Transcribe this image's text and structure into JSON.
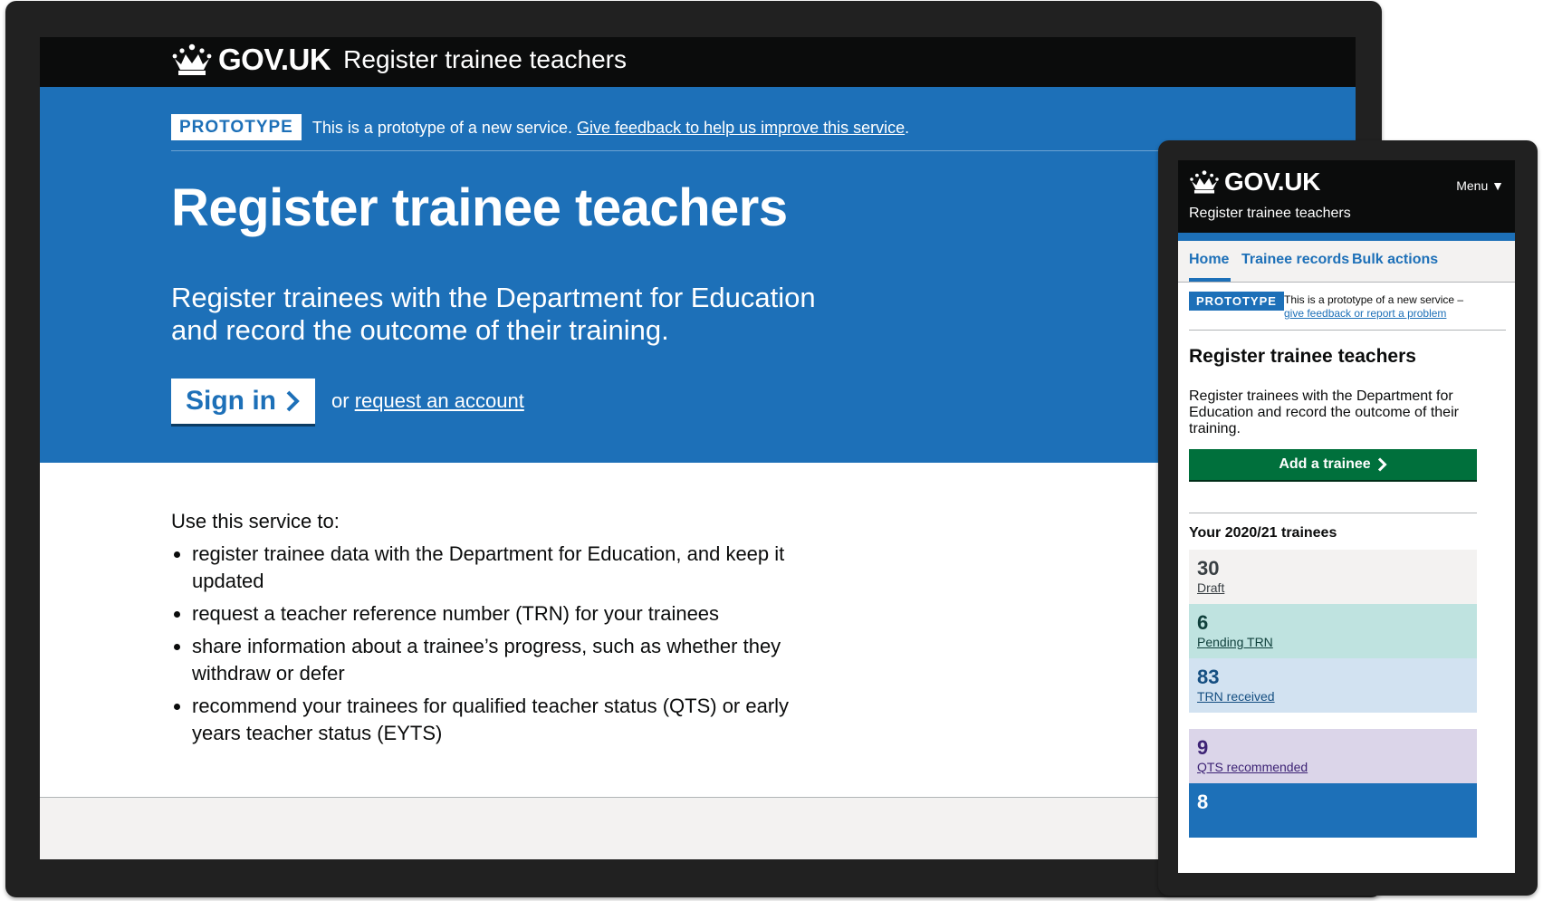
{
  "desktop": {
    "logo": "GOV.UK",
    "service_name": "Register trainee teachers",
    "phase_tag": "PROTOTYPE",
    "phase_text": "This is a prototype of a new service.",
    "phase_link": "Give feedback to help us improve this service",
    "phase_suffix": ".",
    "title": "Register trainee teachers",
    "lede": "Register trainees with the Department for Education and record the outcome of their training.",
    "signin_label": "Sign in",
    "or_text": "or",
    "request_link": "request an account",
    "use_heading": "Use this service to:",
    "bullets": [
      "register trainee data with the Department for Education, and keep it updated",
      "request a teacher reference number (TRN) for your trainees",
      "share information about a trainee’s progress, such as whether they withdraw or defer",
      "recommend your trainees for qualified teacher status (QTS) or early years teacher status (EYTS)"
    ]
  },
  "mobile": {
    "logo": "GOV.UK",
    "menu_label": "Menu ▼",
    "service_name": "Register trainee teachers",
    "nav": [
      "Home",
      "Trainee records",
      "Bulk actions"
    ],
    "phase_tag": "PROTOTYPE",
    "phase_text": "This is a prototype of a new service –",
    "phase_link": "give feedback or report a problem",
    "title": "Register trainee teachers",
    "lede": "Register trainees with the Department for Education and record the outcome of their training.",
    "add_button": "Add a trainee",
    "year_heading": "Your 2020/21 trainees",
    "status_cards": [
      {
        "count": "30",
        "label": "Draft",
        "bg": "#f3f2f1",
        "color": "#383f43"
      },
      {
        "count": "6",
        "label": "Pending TRN",
        "bg": "#bfe3e0",
        "color": "#10403c"
      },
      {
        "count": "83",
        "label": "TRN received",
        "bg": "#d2e2f1",
        "color": "#144e81"
      },
      {
        "count": "9",
        "label": "QTS recommended",
        "bg": "#dbd5e9",
        "color": "#3d2375"
      },
      {
        "count": "8",
        "label": "",
        "bg": "#1d70b8",
        "color": "#ffffff"
      }
    ]
  }
}
